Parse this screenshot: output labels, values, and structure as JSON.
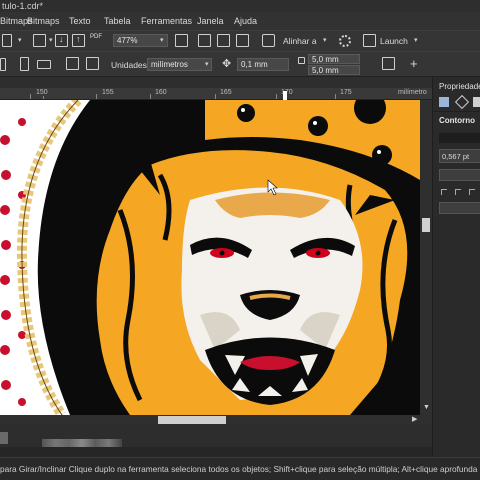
{
  "window": {
    "title": "tulo-1.cdr*"
  },
  "menu": {
    "items": [
      {
        "label": "Bitmaps"
      },
      {
        "label": "Texto"
      },
      {
        "label": "Tabela"
      },
      {
        "label": "Ferramentas"
      },
      {
        "label": "Janela"
      },
      {
        "label": "Ajuda"
      }
    ]
  },
  "toolbar": {
    "zoom": "477%",
    "snap_label": "Alinhar a",
    "launch_label": "Launch"
  },
  "propbar": {
    "units_label": "Unidades:",
    "units_value": "milímetros",
    "nudge": "0,1 mm",
    "dup_x": "5,0 mm",
    "dup_y": "5,0 mm"
  },
  "ruler": {
    "labels": [
      "150",
      "155",
      "160",
      "165",
      "170",
      "175"
    ],
    "unit": "milímetro"
  },
  "panel": {
    "title": "Propriedade",
    "section": "Contorno",
    "width": "0,567 pt"
  },
  "status": {
    "text": "para Girar/Inclinar Clique duplo na ferramenta seleciona todos os objetos; Shift+clique para seleção múltipla; Alt+clique aprofunda"
  },
  "colors": {
    "accent": "#f5a623",
    "dots": "#c8102e",
    "eyes": "#d0021b"
  }
}
